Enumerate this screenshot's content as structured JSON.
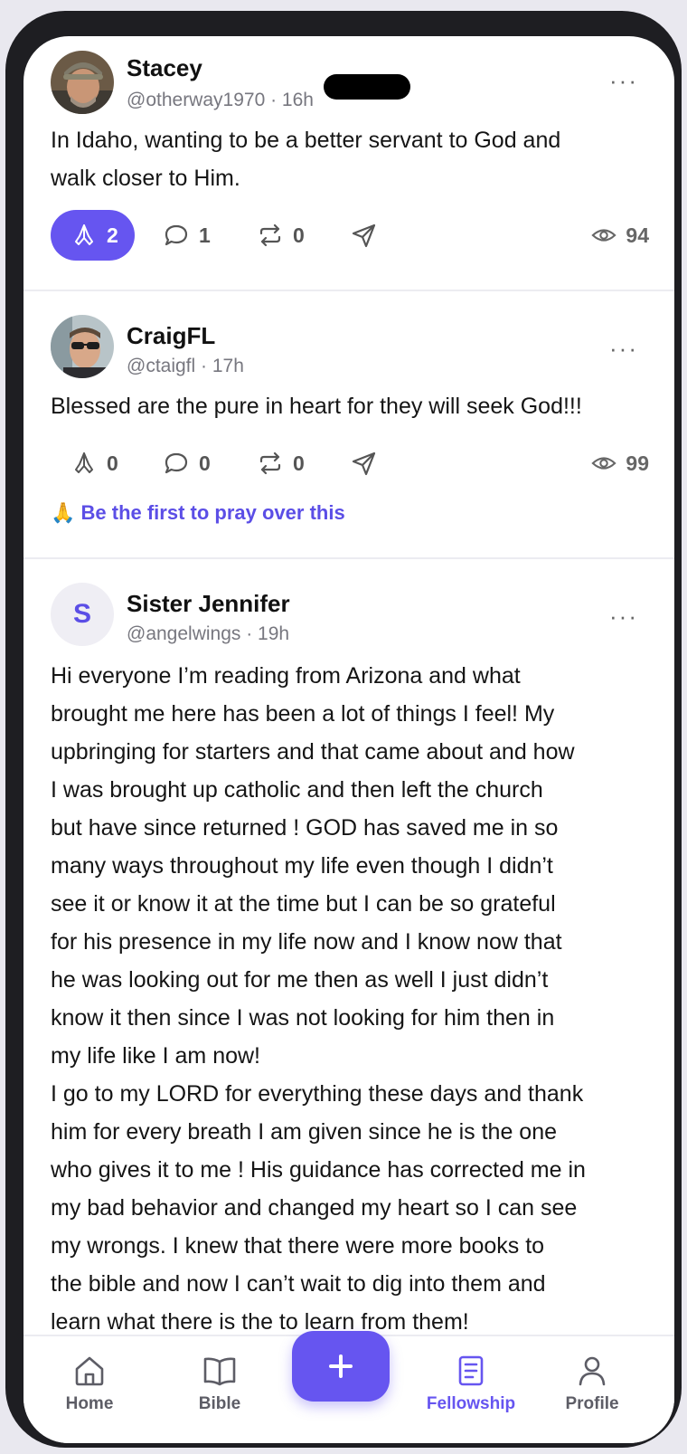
{
  "posts": [
    {
      "name": "Stacey",
      "handle_time": "@otherway1970 · 16h",
      "body": "In Idaho, wanting to be a better servant to God and\nwalk closer to Him.",
      "prayers": "2",
      "comments": "1",
      "reposts": "0",
      "views": "94",
      "prayed": true
    },
    {
      "name": "CraigFL",
      "handle_time": "@ctaigfl · 17h",
      "body": "Blessed are the pure in heart for they will seek God!!!",
      "prayers": "0",
      "comments": "0",
      "reposts": "0",
      "views": "99",
      "prayed": false,
      "cta": "🙏 Be the first to pray over this"
    },
    {
      "name": "Sister Jennifer",
      "avatar_letter": "S",
      "handle_time": "@angelwings · 19h",
      "body": "Hi everyone I’m reading from Arizona and what\nbrought me here has been a lot of things I feel! My\nupbringing for starters and that came about and how\nI was brought up catholic and then left the church\nbut have since returned ! GOD has saved me in so\nmany ways throughout my life even though I didn’t\nsee it or know it at the time but I can be so grateful\nfor his presence in my life now and I know now that\nhe was looking out for me then as well I just didn’t\nknow it then since I was not looking for him then in\nmy life like I am now!\nI go to my LORD for everything these days and thank\nhim for every breath I am given since he is the one\nwho gives it to me ! His guidance has corrected me in\nmy bad behavior and changed my heart so I can see\nmy wrongs. I knew that there were more books to\nthe bible and now I can’t wait to dig into them and\nlearn what there is the to learn from them!"
    }
  ],
  "more_label": "···",
  "tabbar": {
    "home": "Home",
    "bible": "Bible",
    "fellowship": "Fellowship",
    "profile": "Profile",
    "active": "fellowship"
  },
  "colors": {
    "accent": "#6655f0",
    "text": "#151515",
    "muted": "#77777f"
  }
}
